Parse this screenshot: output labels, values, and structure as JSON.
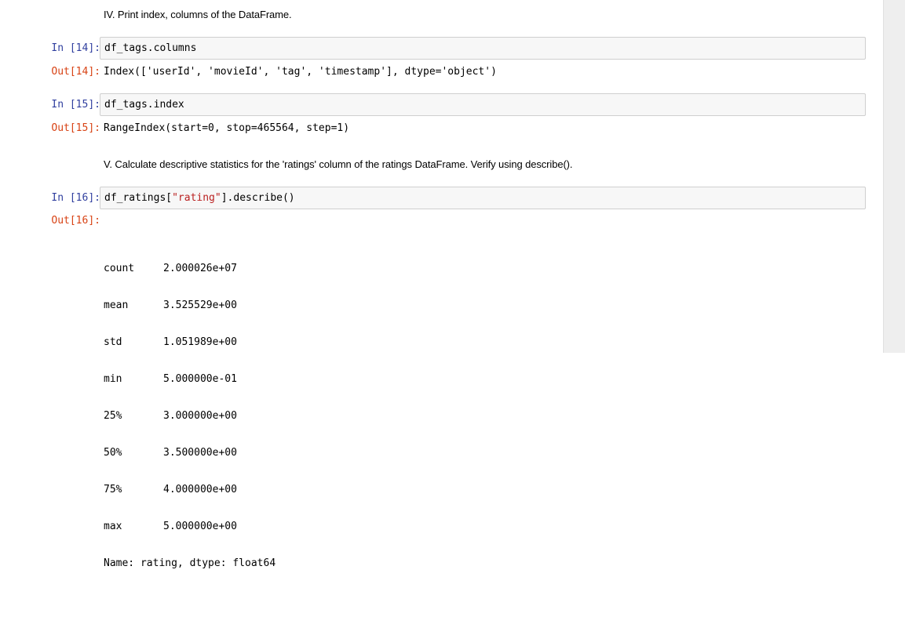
{
  "markdown": {
    "iv": "IV. Print index, columns of the DataFrame.",
    "v": "V. Calculate descriptive statistics for the 'ratings' column of the ratings DataFrame. Verify using describe()."
  },
  "cells": {
    "c14": {
      "in_prompt": "In [14]:",
      "code": "df_tags.columns",
      "out_prompt": "Out[14]:",
      "output": "Index(['userId', 'movieId', 'tag', 'timestamp'], dtype='object')"
    },
    "c15": {
      "in_prompt": "In [15]:",
      "code": "df_tags.index",
      "out_prompt": "Out[15]:",
      "output": "RangeIndex(start=0, stop=465564, step=1)"
    },
    "c16": {
      "in_prompt": "In [16]:",
      "code_pre": "df_ratings[",
      "code_str": "\"rating\"",
      "code_post": "].describe()",
      "out_prompt": "Out[16]:",
      "stats": [
        {
          "label": "count",
          "value": "2.000026e+07"
        },
        {
          "label": "mean",
          "value": "3.525529e+00"
        },
        {
          "label": "std",
          "value": "1.051989e+00"
        },
        {
          "label": "min",
          "value": "5.000000e-01"
        },
        {
          "label": "25%",
          "value": "3.000000e+00"
        },
        {
          "label": "50%",
          "value": "3.500000e+00"
        },
        {
          "label": "75%",
          "value": "4.000000e+00"
        },
        {
          "label": "max",
          "value": "5.000000e+00"
        }
      ],
      "footer": "Name: rating, dtype: float64"
    }
  },
  "colors": {
    "in_prompt": "#303f9f",
    "out_prompt": "#d84315",
    "string": "#ba2121",
    "cell_bg": "#f7f7f7",
    "cell_border": "#cfcfcf"
  }
}
